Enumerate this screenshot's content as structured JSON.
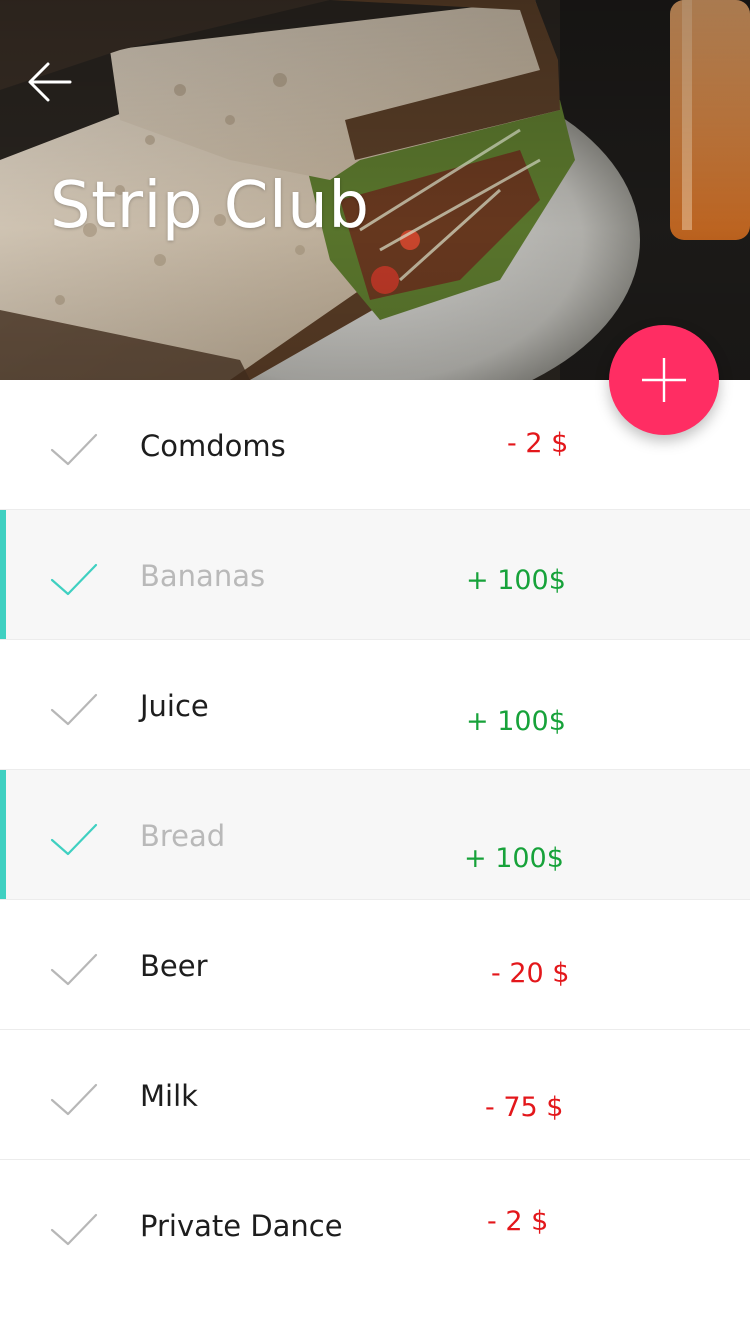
{
  "header": {
    "title": "Strip Club",
    "back_icon": "arrow-left-icon",
    "add_icon": "plus-icon"
  },
  "colors": {
    "accent": "#ff2d63",
    "done_bar": "#3fd0c1",
    "negative": "#e3171b",
    "positive": "#17a23a"
  },
  "items": [
    {
      "label": "Comdoms",
      "amount": "- 2 $",
      "done": false
    },
    {
      "label": "Bananas",
      "amount": "+ 100$",
      "done": true
    },
    {
      "label": "Juice",
      "amount": "+ 100$",
      "done": false
    },
    {
      "label": "Bread",
      "amount": "+ 100$",
      "done": true
    },
    {
      "label": "Beer",
      "amount": "- 20 $",
      "done": false
    },
    {
      "label": "Milk",
      "amount": "- 75 $",
      "done": false
    },
    {
      "label": "Private Dance",
      "amount": "- 2 $",
      "done": false
    }
  ]
}
